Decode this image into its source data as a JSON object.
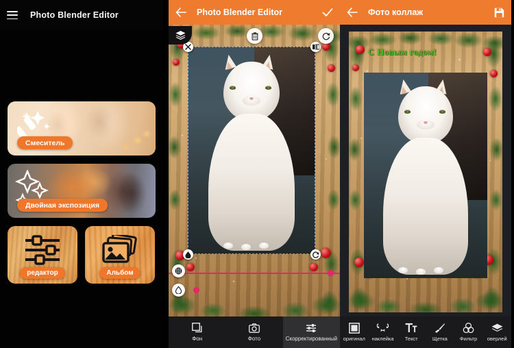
{
  "panel1": {
    "appbar": {
      "title": "Photo Blender Editor",
      "menu_icon": "hamburger-menu-icon"
    },
    "cards": [
      {
        "id": "blender",
        "label": "Смеситель",
        "icon": "magic-wand-sparkle-icon"
      },
      {
        "id": "double-exposure",
        "label": "Двойная экспозиция",
        "icon": "sparkles-icon"
      },
      {
        "id": "editor",
        "label": "редактор",
        "icon": "sliders-icon"
      },
      {
        "id": "album",
        "label": "Альбом",
        "icon": "photos-stack-icon"
      }
    ]
  },
  "panel2": {
    "appbar": {
      "title": "Photo Blender Editor",
      "back_icon": "back-arrow-icon",
      "confirm_icon": "checkmark-icon"
    },
    "tools": {
      "layers_icon": "layers-icon",
      "delete_icon": "trash-icon",
      "rotate_icon": "rotate-refresh-icon",
      "close_handle_icon": "close-x-icon",
      "flip_handle_icon": "flip-horizontal-icon",
      "eyedropper_handle_icon": "eyedropper-icon",
      "resize_handle_icon": "resize-rotate-icon",
      "pattern_icon": "pattern-grid-icon",
      "opacity_icon": "water-drop-icon"
    },
    "slider": {
      "color": "#e8246f",
      "value": 8
    },
    "tabs": [
      {
        "label": "Фон",
        "icon": "background-square-icon",
        "selected": false
      },
      {
        "label": "Фото",
        "icon": "camera-icon",
        "selected": false
      },
      {
        "label": "Скорректированный",
        "icon": "adjust-sliders-icon",
        "selected": true
      }
    ]
  },
  "panel3": {
    "appbar": {
      "title": "Фото коллаж",
      "back_icon": "back-arrow-icon",
      "save_icon": "save-floppy-icon"
    },
    "watermark": {
      "text": "С Новым годом!",
      "color": "#3fbf1f"
    },
    "tabs": [
      {
        "label": "оригинал",
        "icon": "original-square-icon",
        "selected": false
      },
      {
        "label": "наклейка",
        "icon": "cat-sticker-icon",
        "selected": false
      },
      {
        "label": "Текст",
        "icon": "text-tt-icon",
        "selected": false
      },
      {
        "label": "Щетка",
        "icon": "brush-icon",
        "selected": false
      },
      {
        "label": "Фильтр",
        "icon": "filter-circles-icon",
        "selected": false
      },
      {
        "label": "оверлей",
        "icon": "overlay-diamond-icon",
        "selected": false
      }
    ]
  },
  "theme": {
    "accent": "#ef7b2e",
    "pill": "#f0762a",
    "slider": "#e8246f",
    "tabbar_bg": "#1a1a1c",
    "tab_selected_bg": "#303033"
  }
}
